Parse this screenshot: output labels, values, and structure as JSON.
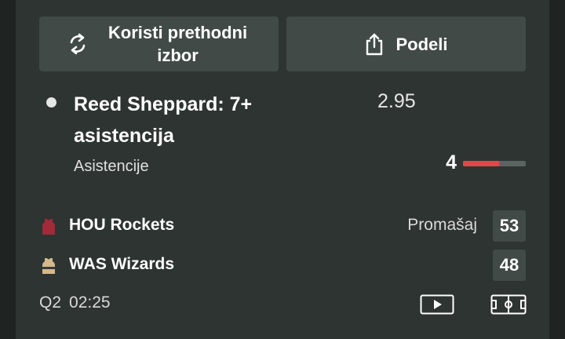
{
  "actions": {
    "reuse_label": "Koristi prethodni izbor",
    "share_label": "Podeli"
  },
  "bet": {
    "title": "Reed Sheppard: 7+ asistencija",
    "odds": "2.95",
    "stat_label": "Asistencije",
    "stat_value": "4",
    "progress_fraction": 0.57
  },
  "teams": {
    "home": {
      "name": "HOU Rockets",
      "status": "Promašaj",
      "score": "53"
    },
    "away": {
      "name": "WAS Wizards",
      "score": "48"
    }
  },
  "game": {
    "period": "Q2",
    "clock": "02:25"
  },
  "colors": {
    "progress_fill": "#e0474c",
    "progress_track": "#5c6462",
    "rockets_jersey": "#a22a3a",
    "wizards_jersey": "#d4b98a"
  },
  "icons": {
    "reuse": "refresh-icon",
    "share": "share-icon",
    "video": "play-video-icon",
    "field": "court-icon"
  }
}
